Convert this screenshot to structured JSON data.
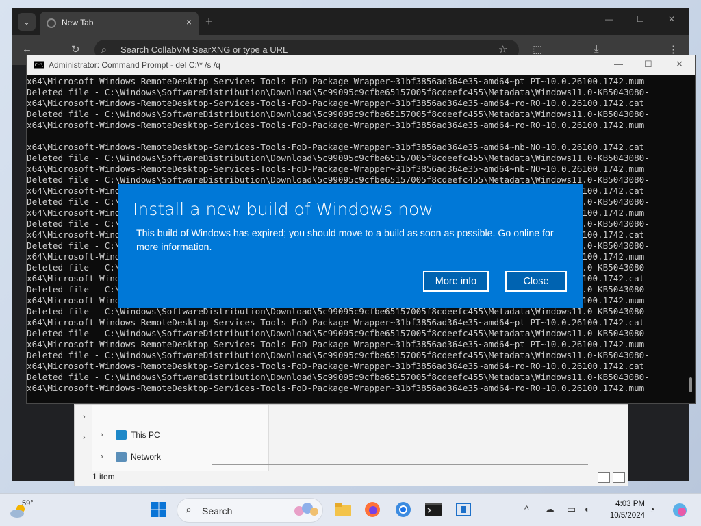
{
  "browser": {
    "tab_title": "New Tab",
    "tab_close": "×",
    "new_tab": "+",
    "address_placeholder": "Search CollabVM SearXNG or type a URL",
    "controls": {
      "minimize": "—",
      "maximize": "☐",
      "close": "✕"
    }
  },
  "cmd": {
    "title": "Administrator: Command Prompt - del  C:\\* /s /q",
    "controls": {
      "minimize": "—",
      "maximize": "☐",
      "close": "✕"
    },
    "lines": [
      "x64\\Microsoft-Windows-RemoteDesktop-Services-Tools-FoD-Package-Wrapper~31bf3856ad364e35~amd64~pt-PT~10.0.26100.1742.mum",
      "Deleted file - C:\\Windows\\SoftwareDistribution\\Download\\5c99095c9cfbe65157005f8cdeefc455\\Metadata\\Windows11.0-KB5043080-",
      "x64\\Microsoft-Windows-RemoteDesktop-Services-Tools-FoD-Package-Wrapper~31bf3856ad364e35~amd64~ro-RO~10.0.26100.1742.cat",
      "Deleted file - C:\\Windows\\SoftwareDistribution\\Download\\5c99095c9cfbe65157005f8cdeefc455\\Metadata\\Windows11.0-KB5043080-",
      "x64\\Microsoft-Windows-RemoteDesktop-Services-Tools-FoD-Package-Wrapper~31bf3856ad364e35~amd64~ro-RO~10.0.26100.1742.mum",
      "",
      "x64\\Microsoft-Windows-RemoteDesktop-Services-Tools-FoD-Package-Wrapper~31bf3856ad364e35~amd64~nb-NO~10.0.26100.1742.cat",
      "Deleted file - C:\\Windows\\SoftwareDistribution\\Download\\5c99095c9cfbe65157005f8cdeefc455\\Metadata\\Windows11.0-KB5043080-",
      "x64\\Microsoft-Windows-RemoteDesktop-Services-Tools-FoD-Package-Wrapper~31bf3856ad364e35~amd64~nb-NO~10.0.26100.1742.mum",
      "Deleted file - C:\\Windows\\SoftwareDistribution\\Download\\5c99095c9cfbe65157005f8cdeefc455\\Metadata\\Windows11.0-KB5043080-",
      "x64\\Microsoft-Windows-RemoteDesktop-Services-Tools-FoD-Package-Wrapper~31bf3856ad364e35~amd64~pt-PT~10.0.26100.1742.cat",
      "Deleted file - C:\\Windows\\SoftwareDistribution\\Download\\5c99095c9cfbe65157005f8cdeefc455\\Metadata\\Windows11.0-KB5043080-",
      "x64\\Microsoft-Windows-RemoteDesktop-Services-Tools-FoD-Package-Wrapper~31bf3856ad364e35~amd64~pt-PT~10.0.26100.1742.mum",
      "Deleted file - C:\\Windows\\SoftwareDistribution\\Download\\5c99095c9cfbe65157005f8cdeefc455\\Metadata\\Windows11.0-KB5043080-",
      "x64\\Microsoft-Windows-RemoteDesktop-Services-Tools-FoD-Package-Wrapper~31bf3856ad364e35~amd64~ro-RO~10.0.26100.1742.cat",
      "Deleted file - C:\\Windows\\SoftwareDistribution\\Download\\5c99095c9cfbe65157005f8cdeefc455\\Metadata\\Windows11.0-KB5043080-",
      "x64\\Microsoft-Windows-RemoteDesktop-Services-Tools-FoD-Package-Wrapper~31bf3856ad364e35~amd64~ro-RO~10.0.26100.1742.mum",
      "Deleted file - C:\\Windows\\SoftwareDistribution\\Download\\5c99095c9cfbe65157005f8cdeefc455\\Metadata\\Windows11.0-KB5043080-",
      "x64\\Microsoft-Windows-RemoteDesktop-Services-Tools-FoD-Package-Wrapper~31bf3856ad364e35~amd64~nb-NO~10.0.26100.1742.cat",
      "Deleted file - C:\\Windows\\SoftwareDistribution\\Download\\5c99095c9cfbe65157005f8cdeefc455\\Metadata\\Windows11.0-KB5043080-",
      "x64\\Microsoft-Windows-RemoteDesktop-Services-Tools-FoD-Package-Wrapper~31bf3856ad364e35~amd64~nb-NO~10.0.26100.1742.mum",
      "Deleted file - C:\\Windows\\SoftwareDistribution\\Download\\5c99095c9cfbe65157005f8cdeefc455\\Metadata\\Windows11.0-KB5043080-",
      "x64\\Microsoft-Windows-RemoteDesktop-Services-Tools-FoD-Package-Wrapper~31bf3856ad364e35~amd64~pt-PT~10.0.26100.1742.cat",
      "Deleted file - C:\\Windows\\SoftwareDistribution\\Download\\5c99095c9cfbe65157005f8cdeefc455\\Metadata\\Windows11.0-KB5043080-",
      "x64\\Microsoft-Windows-RemoteDesktop-Services-Tools-FoD-Package-Wrapper~31bf3856ad364e35~amd64~pt-PT~10.0.26100.1742.mum",
      "Deleted file - C:\\Windows\\SoftwareDistribution\\Download\\5c99095c9cfbe65157005f8cdeefc455\\Metadata\\Windows11.0-KB5043080-",
      "x64\\Microsoft-Windows-RemoteDesktop-Services-Tools-FoD-Package-Wrapper~31bf3856ad364e35~amd64~ro-RO~10.0.26100.1742.cat",
      "Deleted file - C:\\Windows\\SoftwareDistribution\\Download\\5c99095c9cfbe65157005f8cdeefc455\\Metadata\\Windows11.0-KB5043080-",
      "x64\\Microsoft-Windows-RemoteDesktop-Services-Tools-FoD-Package-Wrapper~31bf3856ad364e35~amd64~ro-RO~10.0.26100.1742.mum",
      ""
    ]
  },
  "dialog": {
    "title": "Install a new build of Windows now",
    "body": "This build of Windows has expired; you should move to a build as soon as possible. Go online for more information.",
    "more_info_label": "More info",
    "close_label": "Close",
    "background_color": "#0078d7"
  },
  "explorer": {
    "nav_items": [
      "This PC",
      "Network"
    ],
    "status": "1 item"
  },
  "taskbar": {
    "weather_temp": "59°",
    "search_label": "Search",
    "time": "4:03 PM",
    "date": "10/5/2024"
  },
  "icons": {
    "browser_back": "←",
    "browser_refresh": "↻",
    "browser_search": "⌕",
    "bookmark": "☆",
    "extensions": "⬚",
    "download": "⤓",
    "menu": "⋮",
    "tray_chevron": "^",
    "bell": "🔔"
  }
}
